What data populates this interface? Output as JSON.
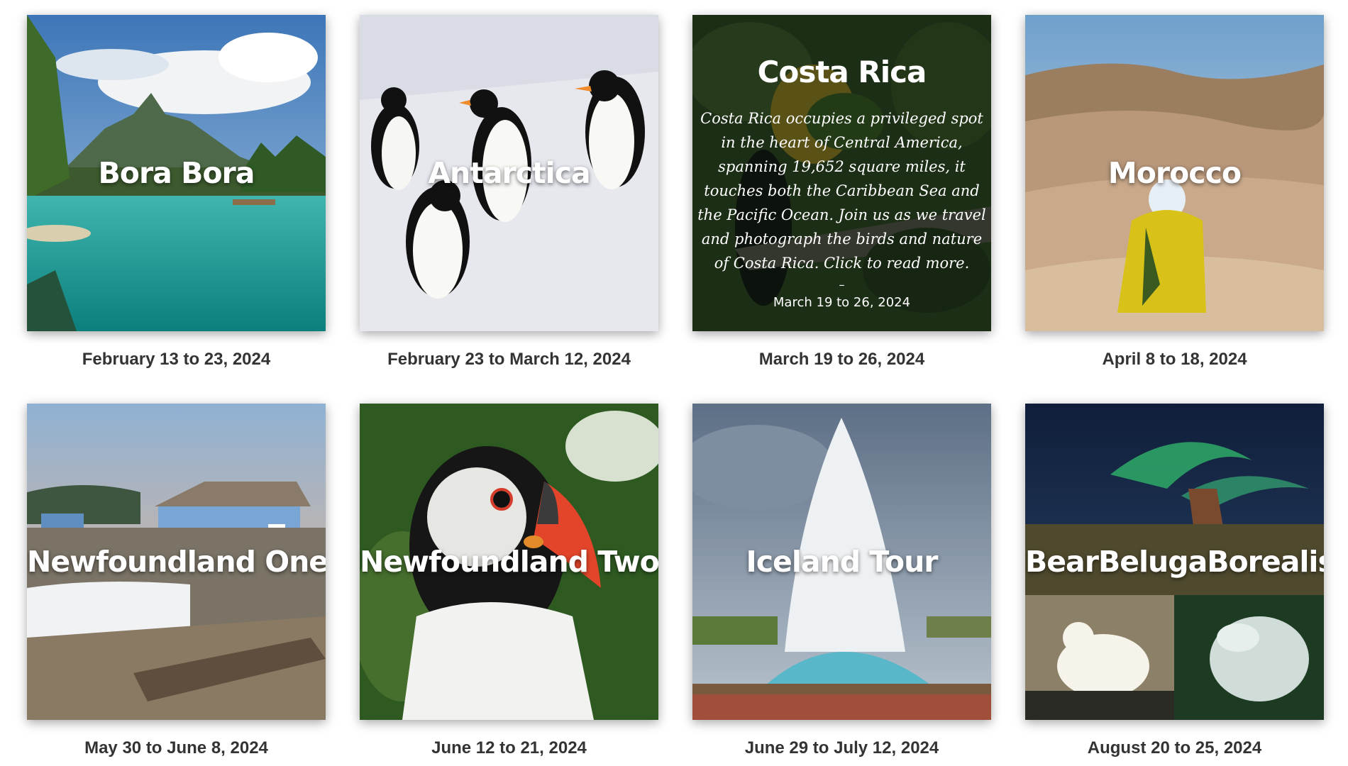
{
  "trips": [
    {
      "title": "Bora Bora",
      "date": "February 13 to 23, 2024"
    },
    {
      "title": "Antarctica",
      "date": "February 23 to March 12, 2024"
    },
    {
      "title": "Costa Rica",
      "date": "March 19 to 26, 2024",
      "description": "Costa Rica occupies a privileged spot in the heart of Central America, spanning 19,652 square miles, it touches both the Caribbean Sea and the Pacific Ocean. Join us as we travel and photograph the birds and nature of Costa Rica. Click to read more.",
      "separator": "–",
      "overlay_date": "March 19 to 26, 2024"
    },
    {
      "title": "Morocco",
      "date": "April 8 to 18, 2024"
    },
    {
      "title": "Newfoundland One",
      "date": "May 30 to June 8, 2024"
    },
    {
      "title": "Newfoundland Two",
      "date": "June 12 to 21, 2024"
    },
    {
      "title": "Iceland Tour",
      "date": "June 29 to July 12, 2024"
    },
    {
      "title": "BearBelugaBorealis",
      "date": "August 20 to 25, 2024"
    }
  ]
}
